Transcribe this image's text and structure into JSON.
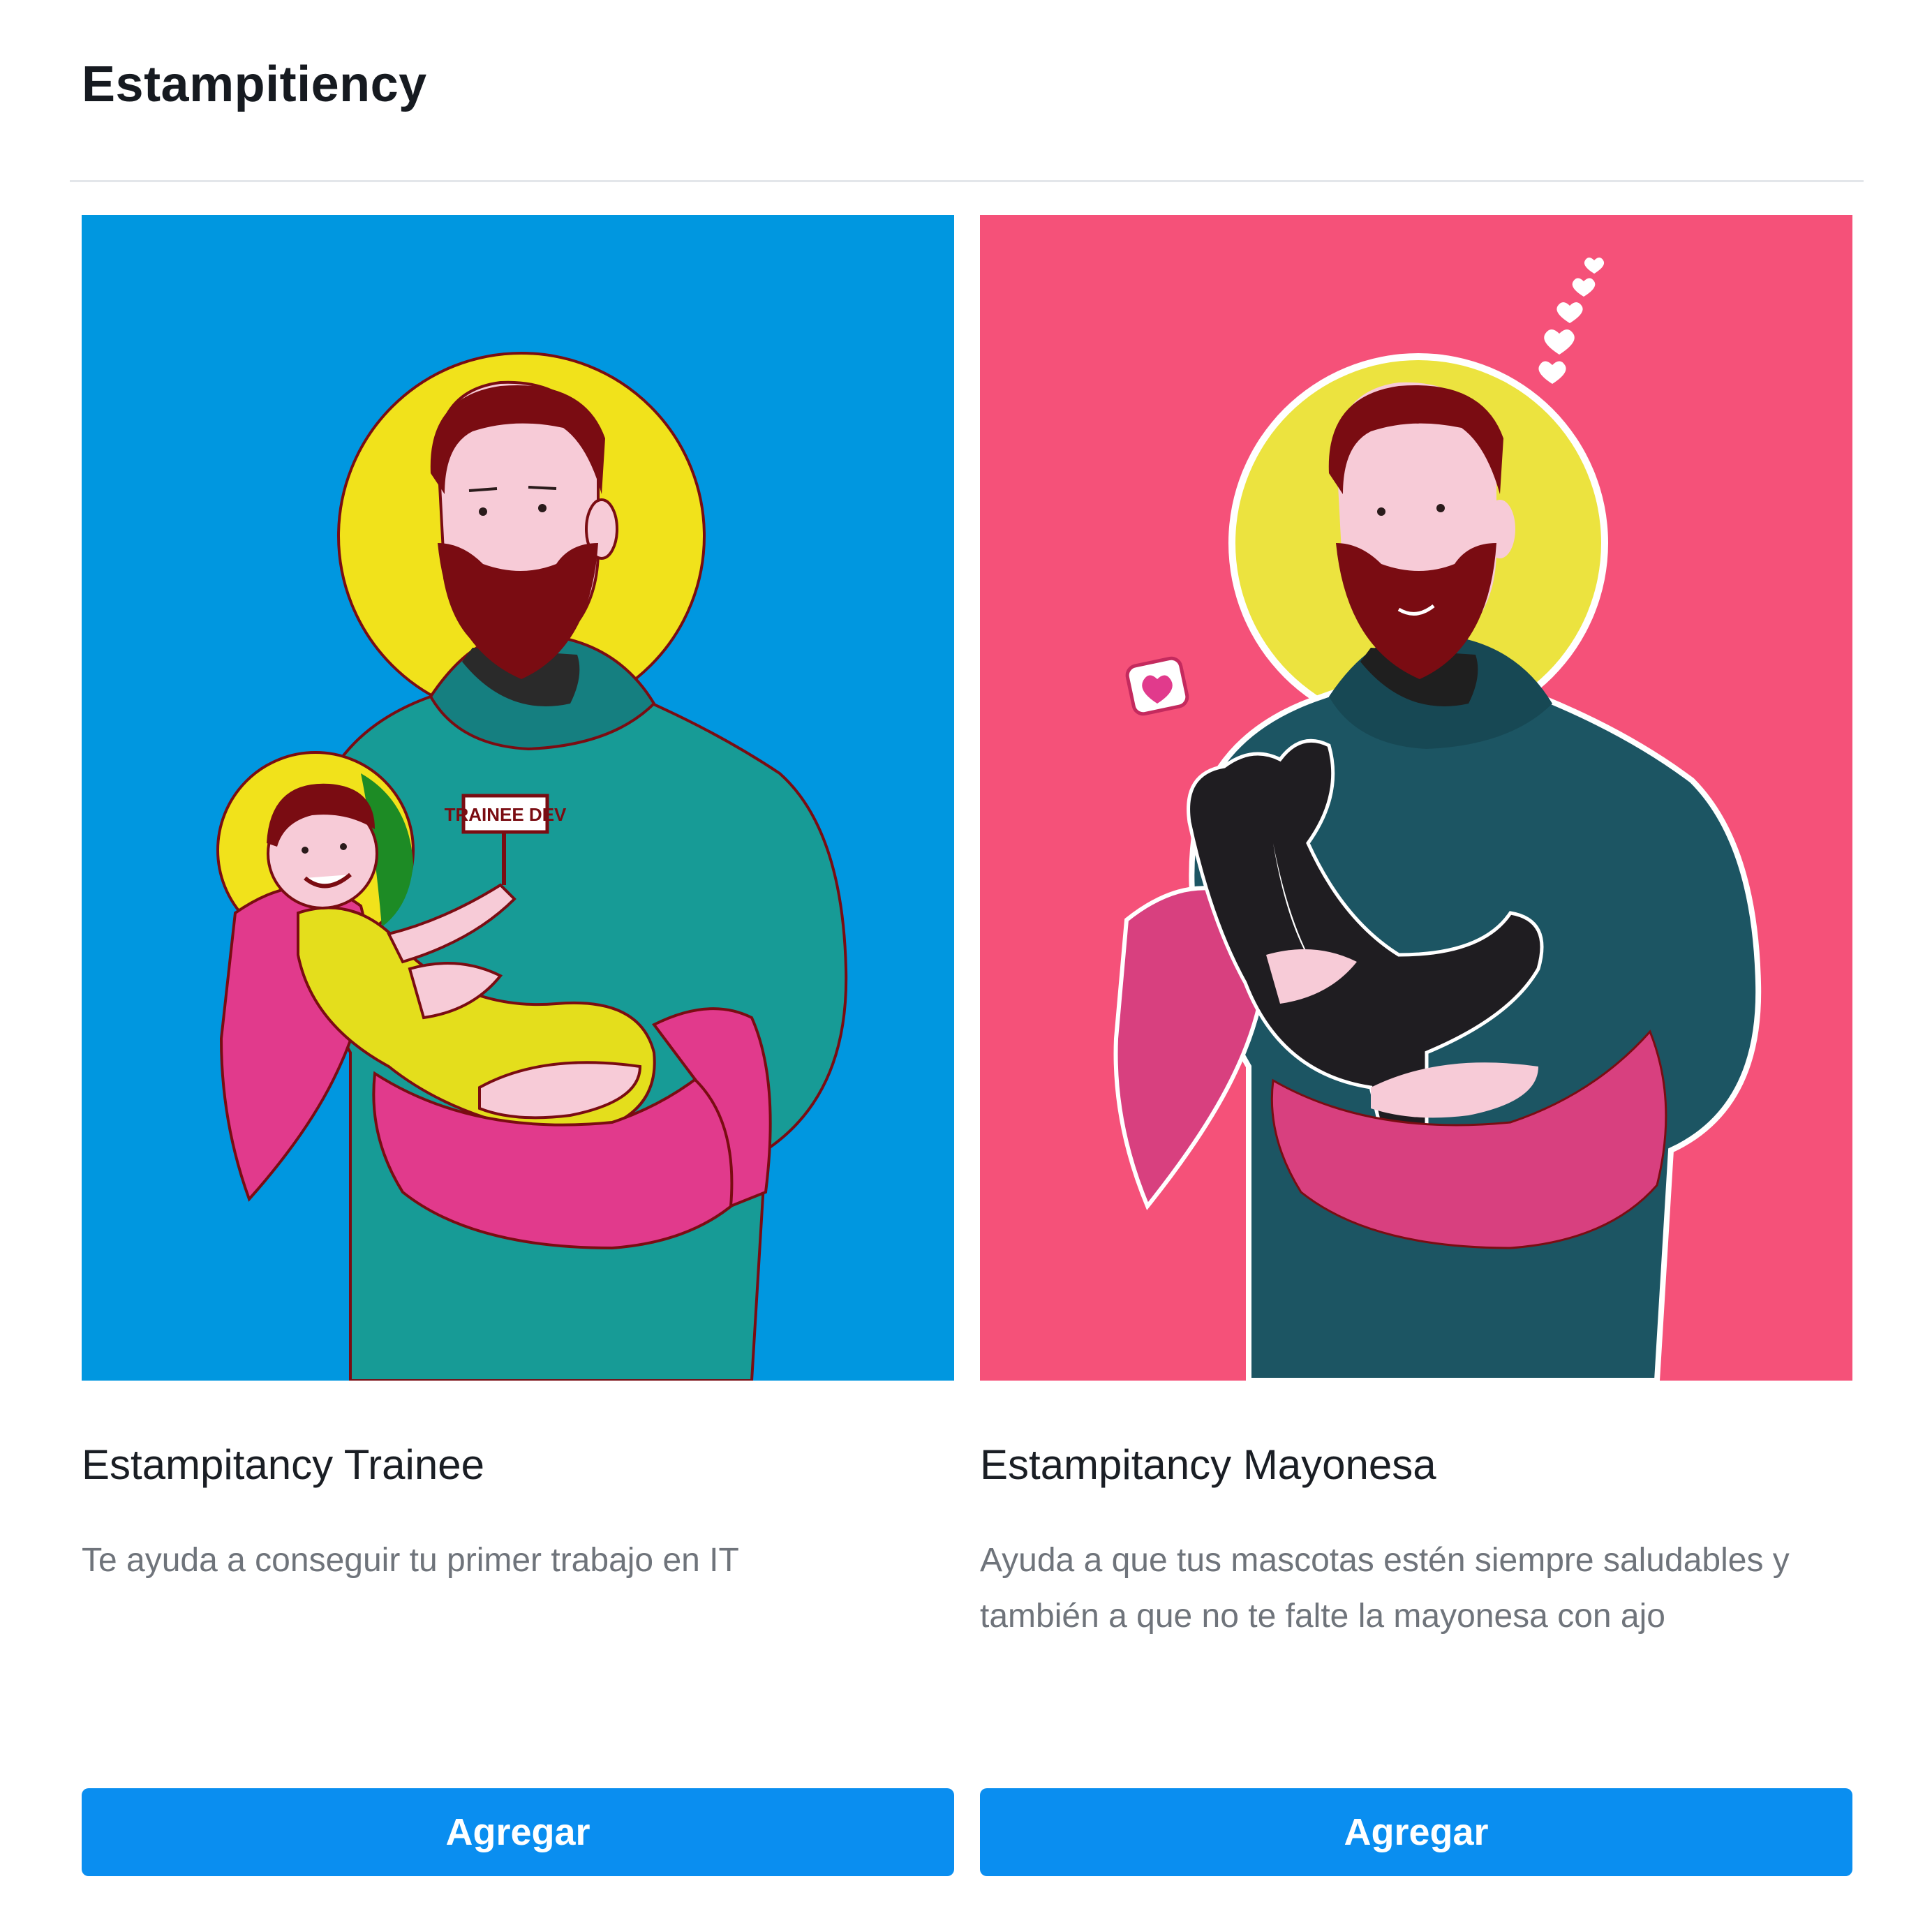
{
  "header": {
    "title": "Estampitiency"
  },
  "products": [
    {
      "name": "Estampitancy Trainee",
      "description": "Te ayuda a conseguir tu primer trabajo en IT",
      "button_label": "Agregar",
      "sign_text": "TRAINEE DEV",
      "image_bg": "#0097e0"
    },
    {
      "name": "Estampitancy Mayonesa",
      "description": "Ayuda a que tus mascotas estén siempre saludables y también a que no te falte la mayonesa con ajo",
      "button_label": "Agregar",
      "image_bg": "#f55179"
    }
  ],
  "colors": {
    "accent": "#0a8ef0",
    "halo": "#f1e21b",
    "hoodie_left": "#179b96",
    "hoodie_right": "#1c5563",
    "beard": "#7a0c12",
    "cloth": "#e13a8c"
  }
}
